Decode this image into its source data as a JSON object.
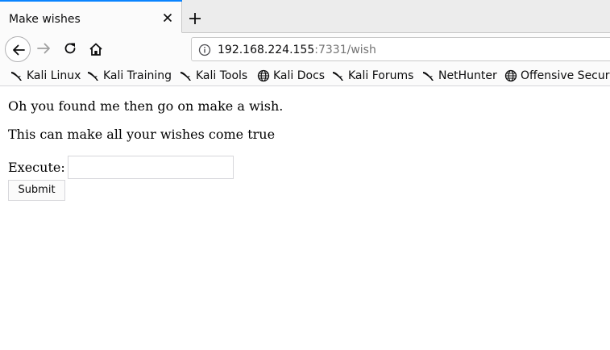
{
  "tab": {
    "title": "Make wishes",
    "close_icon": "close-icon"
  },
  "newtab_icon": "plus-icon",
  "nav": {
    "back_icon": "back-arrow-icon",
    "forward_icon": "forward-arrow-icon",
    "reload_icon": "reload-icon",
    "home_icon": "home-icon"
  },
  "url": {
    "host": "192.168.224.155",
    "rest": ":7331/wish",
    "info_icon": "info-icon"
  },
  "bookmarks": [
    {
      "label": "Kali Linux",
      "icon": "kali-dragon-icon"
    },
    {
      "label": "Kali Training",
      "icon": "kali-dragon-icon"
    },
    {
      "label": "Kali Tools",
      "icon": "kali-dragon-icon"
    },
    {
      "label": "Kali Docs",
      "icon": "globe-icon"
    },
    {
      "label": "Kali Forums",
      "icon": "kali-dragon-icon"
    },
    {
      "label": "NetHunter",
      "icon": "kali-dragon-icon"
    },
    {
      "label": "Offensive Securit",
      "icon": "globe-icon"
    }
  ],
  "page": {
    "line1": "Oh you found me then go on make a wish.",
    "line2": "This can make all your wishes come true",
    "execute_label": "Execute:",
    "execute_value": "",
    "submit_label": "Submit"
  },
  "colors": {
    "accent": "#0a84ff",
    "chrome": "#fbfbfb",
    "tabstrip": "#ececec"
  }
}
